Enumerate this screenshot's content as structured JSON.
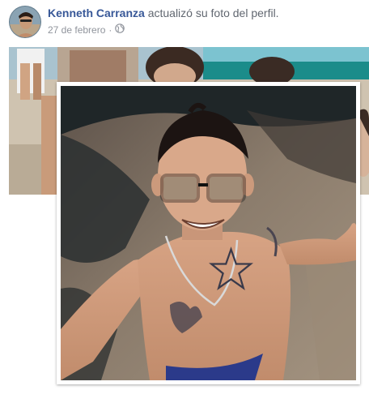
{
  "post": {
    "author_name": "Kenneth Carranza",
    "action_text": "actualizó su foto del perfil.",
    "date": "27 de febrero",
    "separator": "·",
    "privacy_icon": "globe-icon"
  },
  "colors": {
    "author_link": "#385898",
    "meta_text": "#90949c",
    "action_text": "#616770"
  }
}
